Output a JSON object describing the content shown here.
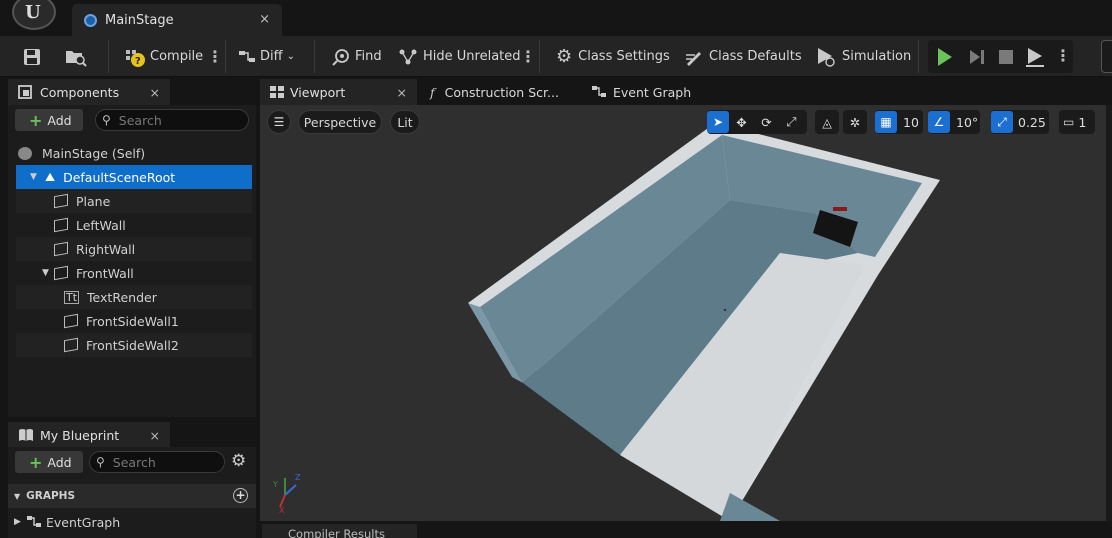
{
  "app": {
    "logo_text": "U"
  },
  "document_tab": {
    "label": "MainStage",
    "close": "×"
  },
  "toolbar": {
    "compile": "Compile",
    "diff": "Diff",
    "find": "Find",
    "hide_unrelated": "Hide Unrelated",
    "class_settings": "Class Settings",
    "class_defaults": "Class Defaults",
    "simulation": "Simulation"
  },
  "components": {
    "tab_label": "Components",
    "close": "×",
    "add_label": "Add",
    "search_placeholder": "Search",
    "tree": [
      {
        "label": "MainStage (Self)"
      },
      {
        "label": "DefaultSceneRoot"
      },
      {
        "label": "Plane"
      },
      {
        "label": "LeftWall"
      },
      {
        "label": "RightWall"
      },
      {
        "label": "FrontWall"
      },
      {
        "label": "TextRender"
      },
      {
        "label": "FrontSideWall1"
      },
      {
        "label": "FrontSideWall2"
      }
    ]
  },
  "my_blueprint": {
    "tab_label": "My Blueprint",
    "close": "×",
    "add_label": "Add",
    "search_placeholder": "Search",
    "graphs_header": "GRAPHS",
    "event_graph": "EventGraph"
  },
  "viewport_tabs": {
    "viewport": "Viewport",
    "close": "×",
    "construction": "Construction Scr...",
    "event_graph": "Event Graph"
  },
  "viewport": {
    "perspective": "Perspective",
    "lit": "Lit",
    "grid_snap": "10",
    "rotation_snap": "10°",
    "scale_snap": "0.25",
    "camera_speed": "1"
  },
  "bottom_tab": {
    "label": "Compiler Results"
  },
  "colors": {
    "selection": "#0e6ec9",
    "accent_blue": "#1a6fd0",
    "play_green": "#6bc15a"
  }
}
